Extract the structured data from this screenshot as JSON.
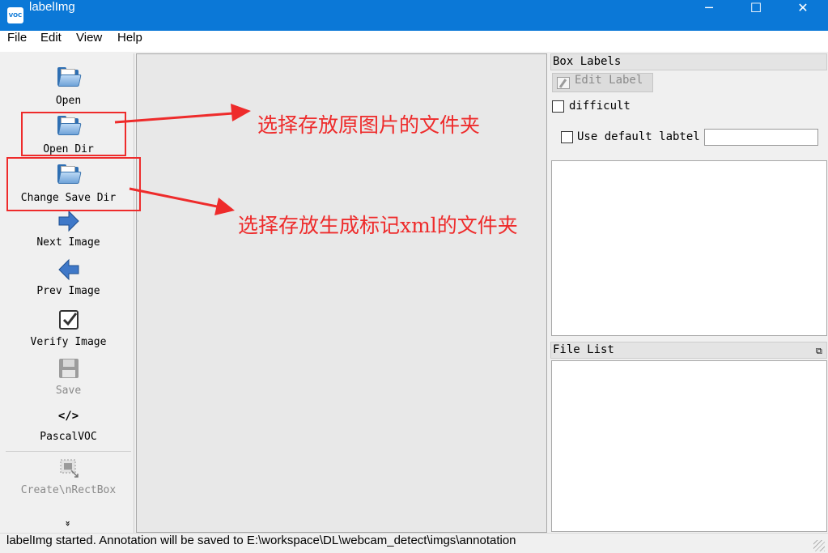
{
  "window": {
    "title": "labelImg",
    "app_icon_text": "VOC",
    "minimize": "─",
    "maximize": "☐",
    "close": "✕"
  },
  "menu": [
    "File",
    "Edit",
    "View",
    "Help"
  ],
  "toolbar": {
    "open": "Open",
    "open_dir": "Open Dir",
    "change_save_dir": "Change Save Dir",
    "next_image": "Next Image",
    "prev_image": "Prev Image",
    "verify_image": "Verify Image",
    "save": "Save",
    "format_icon": "</>",
    "format": "PascalVOC",
    "create_rectbox": "Create\\nRectBox",
    "more": "»"
  },
  "box_labels": {
    "title": "Box Labels",
    "edit_label": "Edit Label",
    "difficult": "difficult",
    "use_default_label": "Use default labtel",
    "default_label_value": ""
  },
  "file_list": {
    "title": "File List"
  },
  "status": "labelImg started. Annotation will be saved to E:\\workspace\\DL\\webcam_detect\\imgs\\annotation",
  "annotations": {
    "open_dir_note": "选择存放原图片的文件夹",
    "save_dir_note": "选择存放生成标记xml的文件夹",
    "color": "#ee2b2b"
  },
  "colors": {
    "titlebar": "#0b78d7",
    "canvas": "#e8e8e8"
  }
}
